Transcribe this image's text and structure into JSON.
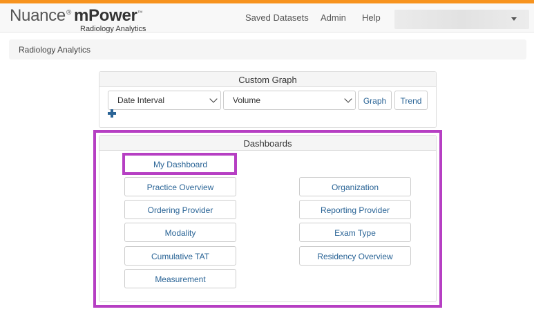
{
  "app": {
    "brand_name": "Nuance",
    "brand_reg": "®",
    "product_name": "mPower",
    "product_tm": "™",
    "subtitle": "Radiology Analytics"
  },
  "nav": {
    "saved_datasets": "Saved Datasets",
    "admin": "Admin",
    "help": "Help"
  },
  "breadcrumb": "Radiology Analytics",
  "custom_graph": {
    "title": "Custom Graph",
    "interval_select": "Date Interval",
    "metric_select": "Volume",
    "graph_label": "Graph",
    "trend_label": "Trend"
  },
  "dashboards": {
    "title": "Dashboards",
    "my_dashboard": "My Dashboard",
    "left": [
      "Practice Overview",
      "Ordering Provider",
      "Modality",
      "Cumulative TAT",
      "Measurement"
    ],
    "right": [
      "Organization",
      "Reporting Provider",
      "Exam Type",
      "Residency Overview"
    ]
  },
  "colors": {
    "accent_top": "#f7931e",
    "link": "#2a6496",
    "highlight": "#b63fc3"
  }
}
